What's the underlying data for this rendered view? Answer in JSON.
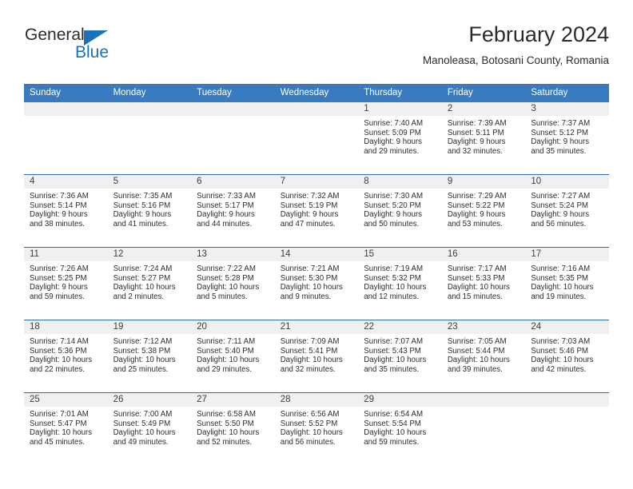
{
  "logo": {
    "word_top": "General",
    "word_bottom": "Blue",
    "accent_color": "#1b72b8",
    "triangle_icon": "triangle-icon"
  },
  "header": {
    "title": "February 2024",
    "subtitle": "Manoleasa, Botosani County, Romania"
  },
  "theme": {
    "header_blue": "#3a7bbf",
    "row_divider_blue": "#2f6da8",
    "daynum_band_gray": "#f0f0f0",
    "text_dark": "#2b2b2b"
  },
  "calendar": {
    "weekday_headers": [
      "Sunday",
      "Monday",
      "Tuesday",
      "Wednesday",
      "Thursday",
      "Friday",
      "Saturday"
    ],
    "weeks": [
      [
        {
          "day": "",
          "lines": []
        },
        {
          "day": "",
          "lines": []
        },
        {
          "day": "",
          "lines": []
        },
        {
          "day": "",
          "lines": []
        },
        {
          "day": "1",
          "lines": [
            "Sunrise: 7:40 AM",
            "Sunset: 5:09 PM",
            "Daylight: 9 hours",
            "and 29 minutes."
          ]
        },
        {
          "day": "2",
          "lines": [
            "Sunrise: 7:39 AM",
            "Sunset: 5:11 PM",
            "Daylight: 9 hours",
            "and 32 minutes."
          ]
        },
        {
          "day": "3",
          "lines": [
            "Sunrise: 7:37 AM",
            "Sunset: 5:12 PM",
            "Daylight: 9 hours",
            "and 35 minutes."
          ]
        }
      ],
      [
        {
          "day": "4",
          "lines": [
            "Sunrise: 7:36 AM",
            "Sunset: 5:14 PM",
            "Daylight: 9 hours",
            "and 38 minutes."
          ]
        },
        {
          "day": "5",
          "lines": [
            "Sunrise: 7:35 AM",
            "Sunset: 5:16 PM",
            "Daylight: 9 hours",
            "and 41 minutes."
          ]
        },
        {
          "day": "6",
          "lines": [
            "Sunrise: 7:33 AM",
            "Sunset: 5:17 PM",
            "Daylight: 9 hours",
            "and 44 minutes."
          ]
        },
        {
          "day": "7",
          "lines": [
            "Sunrise: 7:32 AM",
            "Sunset: 5:19 PM",
            "Daylight: 9 hours",
            "and 47 minutes."
          ]
        },
        {
          "day": "8",
          "lines": [
            "Sunrise: 7:30 AM",
            "Sunset: 5:20 PM",
            "Daylight: 9 hours",
            "and 50 minutes."
          ]
        },
        {
          "day": "9",
          "lines": [
            "Sunrise: 7:29 AM",
            "Sunset: 5:22 PM",
            "Daylight: 9 hours",
            "and 53 minutes."
          ]
        },
        {
          "day": "10",
          "lines": [
            "Sunrise: 7:27 AM",
            "Sunset: 5:24 PM",
            "Daylight: 9 hours",
            "and 56 minutes."
          ]
        }
      ],
      [
        {
          "day": "11",
          "lines": [
            "Sunrise: 7:26 AM",
            "Sunset: 5:25 PM",
            "Daylight: 9 hours",
            "and 59 minutes."
          ]
        },
        {
          "day": "12",
          "lines": [
            "Sunrise: 7:24 AM",
            "Sunset: 5:27 PM",
            "Daylight: 10 hours",
            "and 2 minutes."
          ]
        },
        {
          "day": "13",
          "lines": [
            "Sunrise: 7:22 AM",
            "Sunset: 5:28 PM",
            "Daylight: 10 hours",
            "and 5 minutes."
          ]
        },
        {
          "day": "14",
          "lines": [
            "Sunrise: 7:21 AM",
            "Sunset: 5:30 PM",
            "Daylight: 10 hours",
            "and 9 minutes."
          ]
        },
        {
          "day": "15",
          "lines": [
            "Sunrise: 7:19 AM",
            "Sunset: 5:32 PM",
            "Daylight: 10 hours",
            "and 12 minutes."
          ]
        },
        {
          "day": "16",
          "lines": [
            "Sunrise: 7:17 AM",
            "Sunset: 5:33 PM",
            "Daylight: 10 hours",
            "and 15 minutes."
          ]
        },
        {
          "day": "17",
          "lines": [
            "Sunrise: 7:16 AM",
            "Sunset: 5:35 PM",
            "Daylight: 10 hours",
            "and 19 minutes."
          ]
        }
      ],
      [
        {
          "day": "18",
          "lines": [
            "Sunrise: 7:14 AM",
            "Sunset: 5:36 PM",
            "Daylight: 10 hours",
            "and 22 minutes."
          ]
        },
        {
          "day": "19",
          "lines": [
            "Sunrise: 7:12 AM",
            "Sunset: 5:38 PM",
            "Daylight: 10 hours",
            "and 25 minutes."
          ]
        },
        {
          "day": "20",
          "lines": [
            "Sunrise: 7:11 AM",
            "Sunset: 5:40 PM",
            "Daylight: 10 hours",
            "and 29 minutes."
          ]
        },
        {
          "day": "21",
          "lines": [
            "Sunrise: 7:09 AM",
            "Sunset: 5:41 PM",
            "Daylight: 10 hours",
            "and 32 minutes."
          ]
        },
        {
          "day": "22",
          "lines": [
            "Sunrise: 7:07 AM",
            "Sunset: 5:43 PM",
            "Daylight: 10 hours",
            "and 35 minutes."
          ]
        },
        {
          "day": "23",
          "lines": [
            "Sunrise: 7:05 AM",
            "Sunset: 5:44 PM",
            "Daylight: 10 hours",
            "and 39 minutes."
          ]
        },
        {
          "day": "24",
          "lines": [
            "Sunrise: 7:03 AM",
            "Sunset: 5:46 PM",
            "Daylight: 10 hours",
            "and 42 minutes."
          ]
        }
      ],
      [
        {
          "day": "25",
          "lines": [
            "Sunrise: 7:01 AM",
            "Sunset: 5:47 PM",
            "Daylight: 10 hours",
            "and 45 minutes."
          ]
        },
        {
          "day": "26",
          "lines": [
            "Sunrise: 7:00 AM",
            "Sunset: 5:49 PM",
            "Daylight: 10 hours",
            "and 49 minutes."
          ]
        },
        {
          "day": "27",
          "lines": [
            "Sunrise: 6:58 AM",
            "Sunset: 5:50 PM",
            "Daylight: 10 hours",
            "and 52 minutes."
          ]
        },
        {
          "day": "28",
          "lines": [
            "Sunrise: 6:56 AM",
            "Sunset: 5:52 PM",
            "Daylight: 10 hours",
            "and 56 minutes."
          ]
        },
        {
          "day": "29",
          "lines": [
            "Sunrise: 6:54 AM",
            "Sunset: 5:54 PM",
            "Daylight: 10 hours",
            "and 59 minutes."
          ]
        },
        {
          "day": "",
          "lines": []
        },
        {
          "day": "",
          "lines": []
        }
      ]
    ]
  }
}
